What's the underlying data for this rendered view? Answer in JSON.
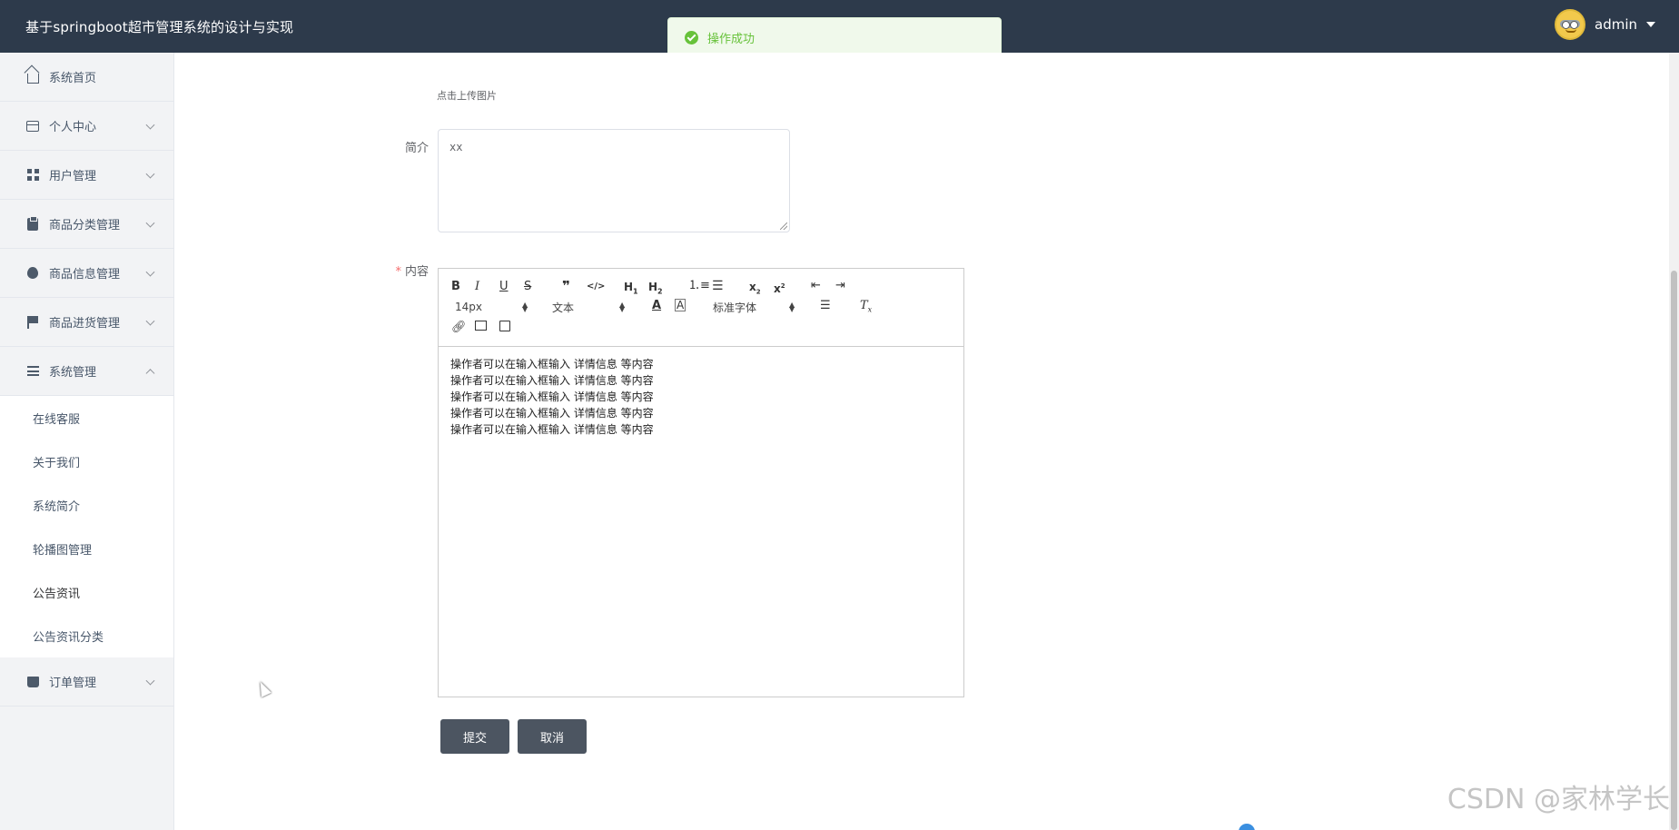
{
  "header": {
    "title": "基于springboot超市管理系统的设计与实现",
    "user_name": "admin"
  },
  "toast": {
    "message": "操作成功"
  },
  "sidebar": {
    "items": [
      {
        "label": "系统首页",
        "icon": "home-icon"
      },
      {
        "label": "个人中心",
        "icon": "card-icon"
      },
      {
        "label": "用户管理",
        "icon": "grid-icon"
      },
      {
        "label": "商品分类管理",
        "icon": "clipboard-icon"
      },
      {
        "label": "商品信息管理",
        "icon": "balloon-icon"
      },
      {
        "label": "商品进货管理",
        "icon": "flag-icon"
      },
      {
        "label": "系统管理",
        "icon": "list-icon"
      }
    ],
    "submenu": [
      "在线客服",
      "关于我们",
      "系统简介",
      "轮播图管理",
      "公告资讯",
      "公告资讯分类"
    ],
    "last_item": {
      "label": "订单管理",
      "icon": "cart-icon"
    }
  },
  "form": {
    "upload_hint": "点击上传图片",
    "intro_label": "简介",
    "intro_value": "xx",
    "content_required_mark": "*",
    "content_label": "内容",
    "editor": {
      "font_size": "14px",
      "header_select": "文本",
      "font_family": "标准字体",
      "lines": [
        "操作者可以在输入框输入 详情信息 等内容",
        "操作者可以在输入框输入 详情信息 等内容",
        "操作者可以在输入框输入 详情信息 等内容",
        "操作者可以在输入框输入 详情信息 等内容",
        "操作者可以在输入框输入 详情信息 等内容"
      ]
    },
    "submit_label": "提交",
    "cancel_label": "取消"
  },
  "watermark": "CSDN @家林学长",
  "colors": {
    "header_bg": "#2d3a4b",
    "success": "#67c23a",
    "button_bg": "#4c5561"
  }
}
